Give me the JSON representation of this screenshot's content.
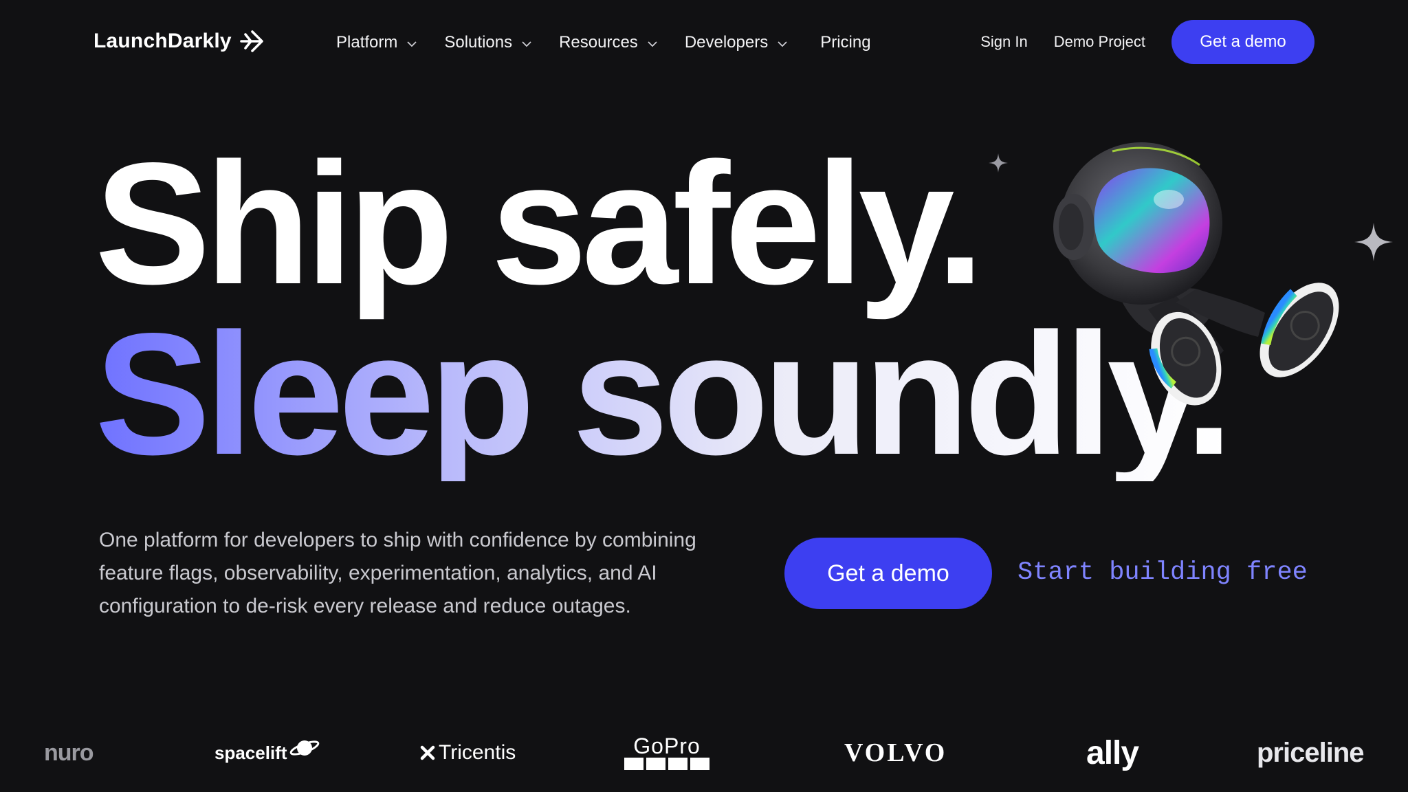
{
  "nav": {
    "logo_text": "LaunchDarkly",
    "items": [
      {
        "label": "Platform"
      },
      {
        "label": "Solutions"
      },
      {
        "label": "Resources"
      },
      {
        "label": "Developers"
      }
    ],
    "pricing": "Pricing",
    "sign_in": "Sign In",
    "demo_project": "Demo Project",
    "cta": "Get a demo"
  },
  "hero": {
    "line1": "Ship safely.",
    "line2": "Sleep soundly.",
    "description": "One platform for developers to ship with confidence by combining feature flags, observability, experimentation, analytics, and AI configuration to de-risk every release and reduce outages.",
    "primary_cta": "Get a demo",
    "secondary_cta": "Start building free"
  },
  "logos": {
    "nuro": "nuro",
    "spacelift": "spacelift",
    "tricentis": "Tricentis",
    "gopro": "GoPro",
    "volvo": "VOLVO",
    "ally": "ally",
    "priceline": "priceline"
  },
  "colors": {
    "background": "#111113",
    "accent": "#3d3ff1",
    "link": "#7f84ff"
  }
}
